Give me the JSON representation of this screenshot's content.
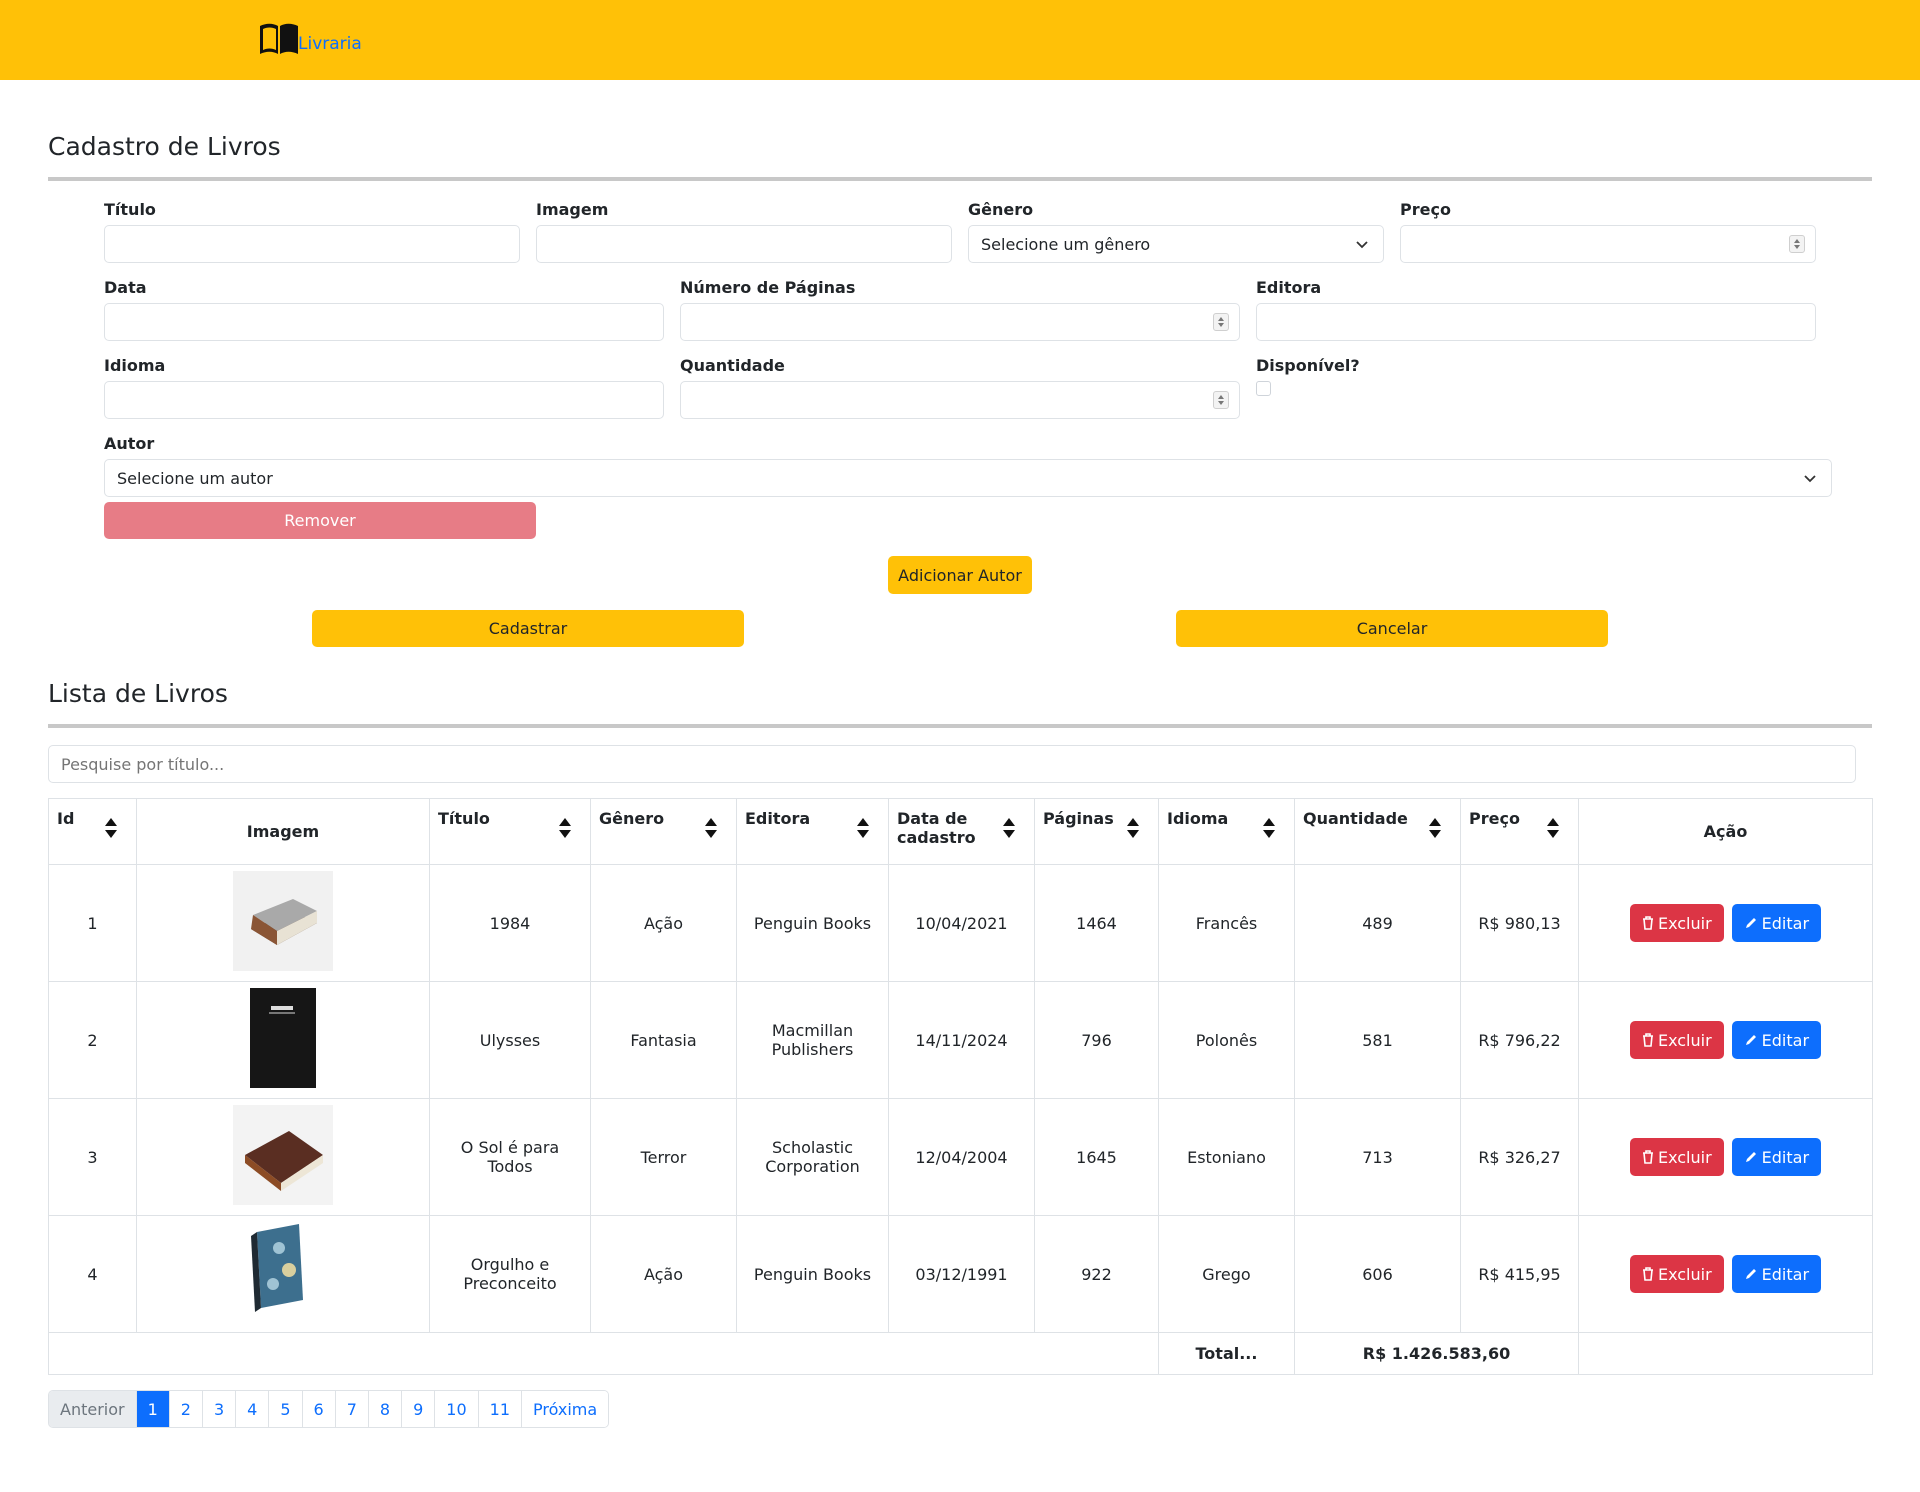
{
  "navbar": {
    "brand": "Livraria"
  },
  "form": {
    "title": "Cadastro de Livros",
    "labels": {
      "titulo": "Título",
      "imagem": "Imagem",
      "genero": "Gênero",
      "preco": "Preço",
      "data": "Data",
      "paginas": "Número de Páginas",
      "editora": "Editora",
      "idioma": "Idioma",
      "quantidade": "Quantidade",
      "disponivel": "Disponível?",
      "autor": "Autor"
    },
    "genero_selected": "Selecione um gênero",
    "autor_selected": "Selecione um autor",
    "remover_label": "Remover",
    "adicionar_autor_label": "Adicionar Autor",
    "cadastrar_label": "Cadastrar",
    "cancelar_label": "Cancelar"
  },
  "list": {
    "title": "Lista de Livros",
    "search_placeholder": "Pesquise por título...",
    "columns": [
      "Id",
      "Imagem",
      "Título",
      "Gênero",
      "Editora",
      "Data de cadastro",
      "Páginas",
      "Idioma",
      "Quantidade",
      "Preço",
      "Ação"
    ],
    "rows": [
      {
        "id": "1",
        "titulo": "1984",
        "genero": "Ação",
        "editora": "Penguin Books",
        "data": "10/04/2021",
        "paginas": "1464",
        "idioma": "Francês",
        "quantidade": "489",
        "preco": "R$ 980,13",
        "cover": "grey-old-book"
      },
      {
        "id": "2",
        "titulo": "Ulysses",
        "genero": "Fantasia",
        "editora": "Macmillan Publishers",
        "data": "14/11/2024",
        "paginas": "796",
        "idioma": "Polonês",
        "quantidade": "581",
        "preco": "R$ 796,22",
        "cover": "black-book"
      },
      {
        "id": "3",
        "titulo": "O Sol é para Todos",
        "genero": "Terror",
        "editora": "Scholastic Corporation",
        "data": "12/04/2004",
        "paginas": "1645",
        "idioma": "Estoniano",
        "quantidade": "713",
        "preco": "R$ 326,27",
        "cover": "brown-leather-book"
      },
      {
        "id": "4",
        "titulo": "Orgulho e Preconceito",
        "genero": "Ação",
        "editora": "Penguin Books",
        "data": "03/12/1991",
        "paginas": "922",
        "idioma": "Grego",
        "quantidade": "606",
        "preco": "R$ 415,95",
        "cover": "marbled-blue-book"
      }
    ],
    "action_delete": "Excluir",
    "action_edit": "Editar",
    "total_label": "Total...",
    "total_value": "R$ 1.426.583,60"
  },
  "pagination": {
    "prev": "Anterior",
    "pages": [
      "1",
      "2",
      "3",
      "4",
      "5",
      "6",
      "7",
      "8",
      "9",
      "10",
      "11"
    ],
    "active": "1",
    "next": "Próxima"
  },
  "colors": {
    "navbar": "#ffc107",
    "primary": "#0d6efd",
    "danger": "#dc3545"
  }
}
